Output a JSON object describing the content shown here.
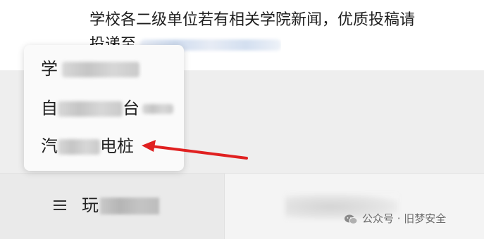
{
  "article": {
    "line1": "学校各二级单位若有相关学院新闻，优质投稿请",
    "line2_prefix": "投递至"
  },
  "popup_menu": {
    "items": [
      {
        "visible_text": "学"
      },
      {
        "visible_text_start": "自",
        "visible_text_end": "台"
      },
      {
        "visible_text_start": "汽",
        "visible_text_end": "电桩"
      }
    ]
  },
  "bottom_menu": {
    "left_icon": "hamburger-icon",
    "left_label_visible": "玩"
  },
  "watermark": {
    "text": "公众号 · 旧梦安全",
    "icon": "wechat-icon"
  },
  "colors": {
    "arrow": "#e02020",
    "link": "#3a64a8",
    "popup_bg": "#fafafa",
    "band_gray": "#eeeeee"
  }
}
